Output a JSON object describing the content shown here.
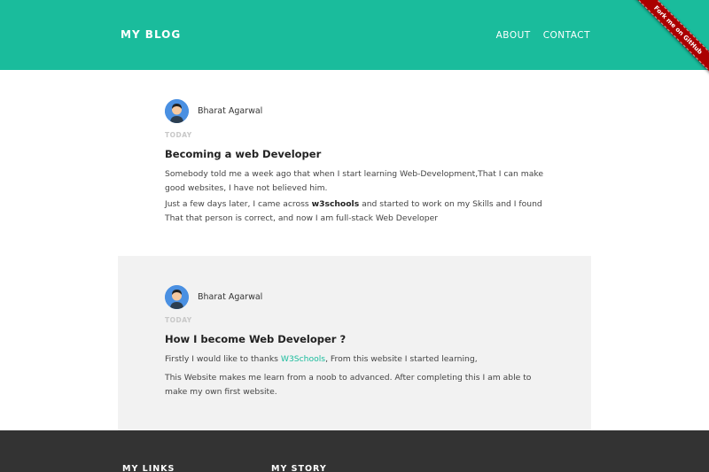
{
  "header": {
    "brand": "MY BLOG",
    "nav": [
      "ABOUT",
      "CONTACT"
    ],
    "ribbon": "Fork me on GitHub",
    "accent_color": "#1abc9c"
  },
  "posts": [
    {
      "author": "Bharat Agarwal",
      "date": "TODAY",
      "title": "Becoming a web Developer",
      "p1": "Somebody told me a week ago that when I start learning Web-Development,That I can make good websites, I have not believed him.",
      "p2_pre": "Just a few days later, I came across ",
      "p2_bold": "w3schools",
      "p2_post": " and started to work on my Skills and I found That that person is correct, and now I am full-stack Web Developer"
    },
    {
      "author": "Bharat Agarwal",
      "date": "TODAY",
      "title": "How I become Web Developer ?",
      "p1_pre": "Firstly I would like to thanks ",
      "p1_link": "W3Schools",
      "p1_post": ", From this website I started learning,",
      "p2": "This Website makes me learn from a noob to advanced. After completing this I am able to make my own first website."
    }
  ],
  "footer": {
    "col1": "MY LINKS",
    "col2": "MY STORY"
  }
}
